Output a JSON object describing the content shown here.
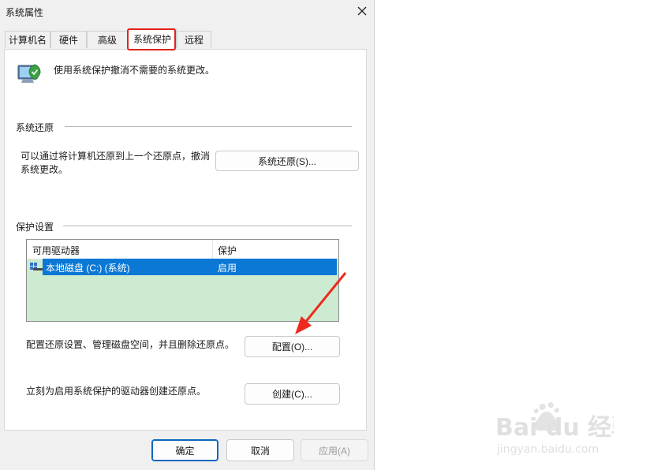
{
  "window": {
    "title": "系统属性"
  },
  "tabs": [
    {
      "label": "计算机名"
    },
    {
      "label": "硬件"
    },
    {
      "label": "高级"
    },
    {
      "label": "系统保护"
    },
    {
      "label": "远程"
    }
  ],
  "active_tab": "系统保护",
  "header": {
    "description": "使用系统保护撤消不需要的系统更改。",
    "icon": "system-protection-icon"
  },
  "restore": {
    "group_label": "系统还原",
    "text_line1": "可以通过将计算机还原到上一个还原点，撤消",
    "text_line2": "系统更改。",
    "button_label": "系统还原(S)..."
  },
  "protection": {
    "group_label": "保护设置",
    "columns": [
      "可用驱动器",
      "保护"
    ],
    "rows": [
      {
        "drive": "本地磁盘 (C:) (系统)",
        "protection": "启用"
      }
    ],
    "configure_text": "配置还原设置、管理磁盘空间，并且删除还原点。",
    "configure_button": "配置(O)...",
    "create_text": "立刻为启用系统保护的驱动器创建还原点。",
    "create_button": "创建(C)..."
  },
  "footer": {
    "ok": "确定",
    "cancel": "取消",
    "apply": "应用(A)"
  },
  "colors": {
    "selection": "#0a78d4",
    "list_bg": "#cdebd0",
    "highlight": "#e3221c",
    "arrow": "#ee2a1f"
  },
  "watermark": {
    "brand": "Bai du 经验",
    "url": "jingyan.baidu.com"
  }
}
